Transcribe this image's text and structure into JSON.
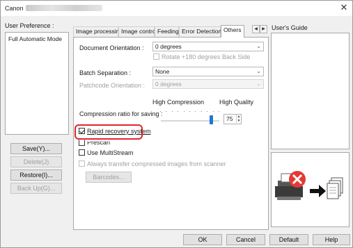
{
  "window": {
    "title": "Canon",
    "close_glyph": "✕"
  },
  "left_panel": {
    "label": "User Preference :",
    "items": [
      "Full Automatic Mode"
    ],
    "buttons": {
      "save": "Save(Y)...",
      "delete": "Delete(J)",
      "restore": "Restore(I)...",
      "backup": "Back Up(G)..."
    }
  },
  "tabs": {
    "items": [
      "Image processing",
      "Image control",
      "Feeding",
      "Error Detection",
      "Others"
    ],
    "active": "Others",
    "nav_left": "◀",
    "nav_right": "▶"
  },
  "others": {
    "doc_orientation_label": "Document Orientation :",
    "doc_orientation_value": "0 degrees",
    "rotate_label": "Rotate +180 degrees Back Side",
    "batch_sep_label": "Batch Separation :",
    "batch_sep_value": "None",
    "patchcode_label": "Patchcode Orientation :",
    "patchcode_value": "0 degrees",
    "high_compression": "High Compression",
    "high_quality": "High Quality",
    "compression_label": "Compression ratio for saving :",
    "compression_value": "75",
    "compression_level": 0.86,
    "rapid_recovery_label": "Rapid recovery system",
    "rapid_recovery_checked": true,
    "prescan_label": "Prescan",
    "multistream_label": "Use MultiStream",
    "always_transfer_label": "Always transfer compressed images from scanner",
    "barcodes_button": "Barcodes..."
  },
  "right_panel": {
    "label": "User's Guide"
  },
  "footer": {
    "ok": "OK",
    "cancel": "Cancel",
    "default": "Default",
    "help": "Help"
  },
  "colors": {
    "highlight": "#e0262a",
    "slider_thumb": "#1e78d6",
    "error_red": "#e53935"
  },
  "icons": [
    "close-icon",
    "combo-arrow-icon",
    "scanner-error-icon",
    "arrow-right-icon",
    "document-stack-icon"
  ]
}
